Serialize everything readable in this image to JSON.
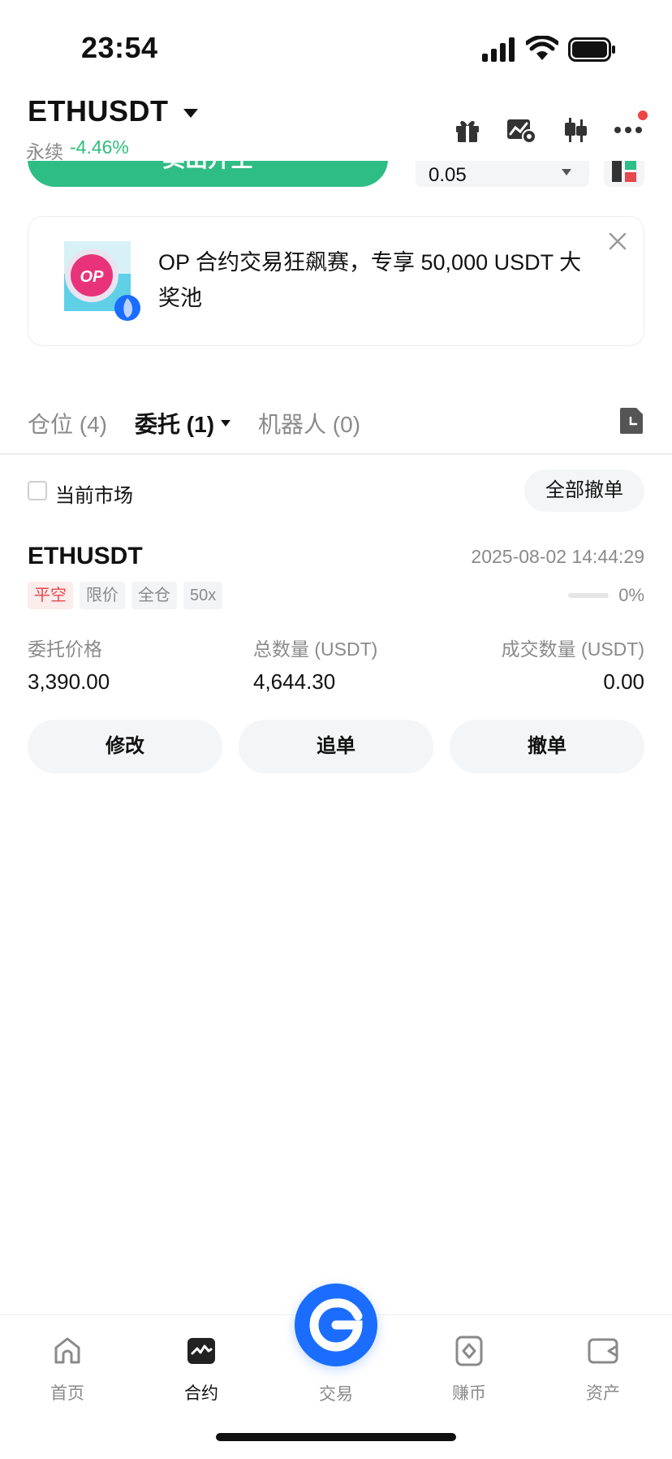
{
  "status_bar": {
    "time": "23:54"
  },
  "header": {
    "symbol": "ETHUSDT",
    "contract_type": "永续",
    "change": "-4.46%",
    "icons": [
      "gift-icon",
      "chart-settings-icon",
      "candlestick-icon",
      "more-icon"
    ]
  },
  "trade_panel": {
    "sell_label": "卖出开空",
    "quantity": "0.05"
  },
  "banner": {
    "text": "OP 合约交易狂飙赛，专享 50,000 USDT 大奖池",
    "logo_text": "OP"
  },
  "tabs": [
    {
      "label": "仓位 (4)"
    },
    {
      "label": "委托 (1)"
    },
    {
      "label": "机器人 (0)"
    }
  ],
  "filter": {
    "current_market_label": "当前市场",
    "cancel_all_label": "全部撤单"
  },
  "order": {
    "symbol": "ETHUSDT",
    "time": "2025-08-02 14:44:29",
    "tags": [
      "平空",
      "限价",
      "全仓",
      "50x"
    ],
    "fill_percent": 0,
    "fill_text": "0%",
    "price_label": "委托价格",
    "price": "3,390.00",
    "total_label": "总数量 (USDT)",
    "total": "4,644.30",
    "filled_label": "成交数量 (USDT)",
    "filled": "0.00",
    "actions": {
      "modify": "修改",
      "chase": "追单",
      "cancel": "撤单"
    }
  },
  "bottom_nav": {
    "items": [
      {
        "label": "首页"
      },
      {
        "label": "合约"
      },
      {
        "label": "交易"
      },
      {
        "label": "赚币"
      },
      {
        "label": "资产"
      }
    ]
  },
  "colors": {
    "green": "#2ebd85",
    "red": "#e5484d",
    "blue": "#1a6dff"
  }
}
